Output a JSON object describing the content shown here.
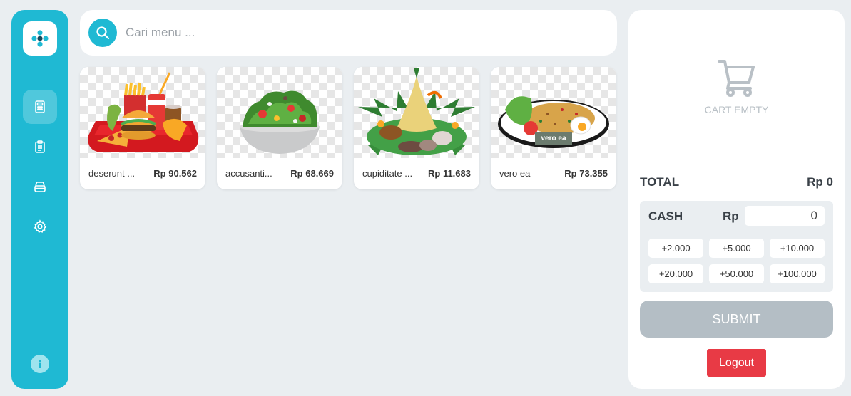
{
  "search": {
    "placeholder": "Cari menu ..."
  },
  "sidebar": {
    "items": [
      {
        "icon": "calculator-icon",
        "active": true
      },
      {
        "icon": "clipboard-icon",
        "active": false
      },
      {
        "icon": "archive-icon",
        "active": false
      },
      {
        "icon": "gear-icon",
        "active": false
      }
    ],
    "info_icon": "info-icon"
  },
  "products": [
    {
      "name": "deserunt ...",
      "price": "Rp 90.562",
      "image": "fast-food-tray-image"
    },
    {
      "name": "accusanti...",
      "price": "Rp 68.669",
      "image": "salad-bowl-image"
    },
    {
      "name": "cupiditate ...",
      "price": "Rp 11.683",
      "image": "nasi-tumpeng-image"
    },
    {
      "name": "vero ea",
      "price": "Rp 73.355",
      "image": "fried-rice-plate-image",
      "image_label": "vero ea"
    }
  ],
  "cart": {
    "empty_label": "CART EMPTY",
    "total_label": "TOTAL",
    "total_value": "Rp 0",
    "cash_label": "CASH",
    "currency": "Rp",
    "cash_value": "0",
    "quick_amounts": [
      "+2.000",
      "+5.000",
      "+10.000",
      "+20.000",
      "+50.000",
      "+100.000"
    ],
    "submit_label": "SUBMIT",
    "logout_label": "Logout"
  },
  "colors": {
    "accent": "#1fb9d3",
    "background": "#eaeef1",
    "submit_disabled": "#b4bec5",
    "logout": "#e83a45"
  }
}
